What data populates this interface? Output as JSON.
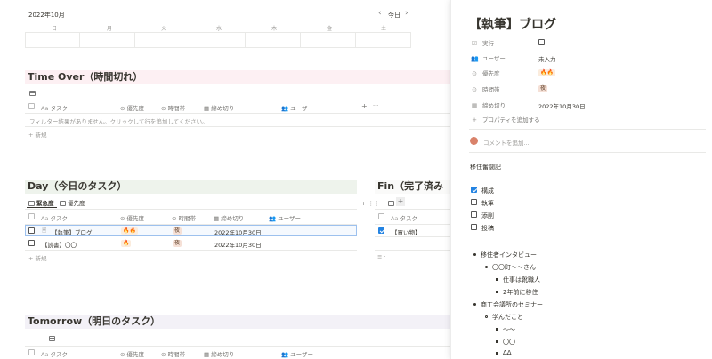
{
  "calendar": {
    "month": "2022年10月",
    "today_label": "今日",
    "prev": "‹",
    "next": "›",
    "weekdays": [
      "日",
      "月",
      "火",
      "水",
      "木",
      "金",
      "土"
    ]
  },
  "time_over": {
    "title": "Time Over（時間切れ）",
    "columns": [
      "タスク",
      "優先度",
      "時間帯",
      "締め切り",
      "ユーザー"
    ],
    "empty_message": "フィルター結果がありません。クリックして行を追加してください。",
    "new_label": "新規"
  },
  "day": {
    "title": "Day（今日のタスク）",
    "tabs": [
      "緊急度",
      "優先度"
    ],
    "columns": [
      "タスク",
      "優先度",
      "時間帯",
      "締め切り",
      "ユーザー"
    ],
    "rows": [
      {
        "task": "【執筆】ブログ",
        "priority": "🔥🔥",
        "time": "夜",
        "deadline": "2022年10月30日"
      },
      {
        "task": "【読書】〇〇",
        "priority": "🔥",
        "time": "夜",
        "deadline": "2022年10月30日"
      }
    ],
    "new_label": "新規"
  },
  "fin": {
    "title": "Fin（完了済みタ",
    "columns": [
      "タスク"
    ],
    "rows": [
      {
        "task": "【買い物】"
      }
    ]
  },
  "tomorrow": {
    "title": "Tomorrow（明日のタスク）",
    "columns": [
      "タスク",
      "優先度",
      "時間帯",
      "締め切り",
      "ユーザー"
    ]
  },
  "panel": {
    "title": "【執筆】ブログ",
    "props": [
      {
        "icon": "checkbox-icon",
        "label": "実行",
        "value": ""
      },
      {
        "icon": "person-icon",
        "label": "ユーザー",
        "value": "未入力"
      },
      {
        "icon": "select-icon",
        "label": "優先度",
        "value": "🔥🔥"
      },
      {
        "icon": "select-icon",
        "label": "時間帯",
        "value": "夜"
      },
      {
        "icon": "calendar-icon",
        "label": "締め切り",
        "value": "2022年10月30日"
      }
    ],
    "add_property": "プロパティを追加する",
    "comment_placeholder": "コメントを追加...",
    "section_heading": "移住奮闘記",
    "todos": [
      {
        "label": "構成",
        "checked": true
      },
      {
        "label": "執筆",
        "checked": false
      },
      {
        "label": "添削",
        "checked": false
      },
      {
        "label": "投稿",
        "checked": false
      }
    ],
    "bullets": {
      "b1": "移住者インタビュー",
      "b1_1": "〇〇町〜〜さん",
      "b1_1_1": "仕事は靴職人",
      "b1_1_2": "2年前に移住",
      "b2": "商工会議所のセミナー",
      "b2_1": "学んだこと",
      "b2_1_1": "〜〜",
      "b2_1_2": "〇〇",
      "b2_1_3": "ΔΔ"
    }
  }
}
